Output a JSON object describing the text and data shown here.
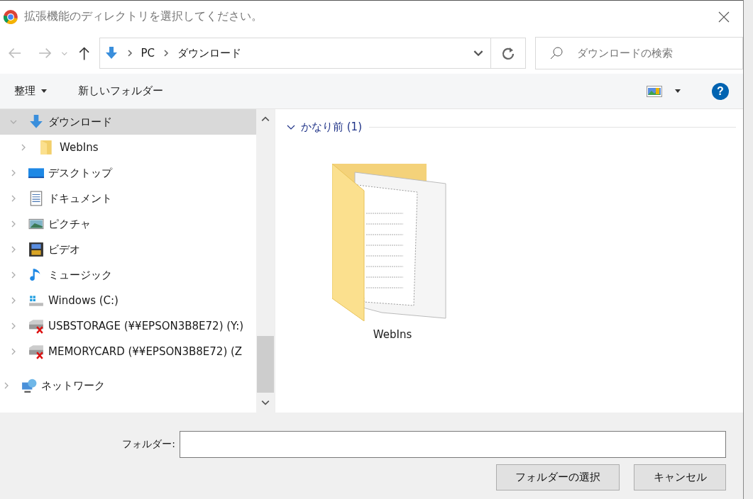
{
  "window": {
    "title": "拡張機能のディレクトリを選択してください。"
  },
  "address_bar": {
    "crumbs": [
      "PC",
      "ダウンロード"
    ]
  },
  "search": {
    "placeholder": "ダウンロードの検索"
  },
  "toolbar": {
    "organize": "整理",
    "new_folder": "新しいフォルダー",
    "help": "?"
  },
  "nav_tree": [
    {
      "label": "ダウンロード",
      "kind": "download",
      "selected": true,
      "expanded": true,
      "children": [
        {
          "label": "WebIns",
          "kind": "folder",
          "selected": false,
          "expanded": false
        }
      ]
    },
    {
      "label": "デスクトップ",
      "kind": "desktop",
      "selected": false,
      "expanded": false
    },
    {
      "label": "ドキュメント",
      "kind": "document",
      "selected": false,
      "expanded": false
    },
    {
      "label": "ピクチャ",
      "kind": "picture",
      "selected": false,
      "expanded": false
    },
    {
      "label": "ビデオ",
      "kind": "video",
      "selected": false,
      "expanded": false
    },
    {
      "label": "ミュージック",
      "kind": "music",
      "selected": false,
      "expanded": false
    },
    {
      "label": "Windows (C:)",
      "kind": "drive",
      "selected": false,
      "expanded": false
    },
    {
      "label": "USBSTORAGE (¥¥EPSON3B8E72) (Y:)",
      "kind": "netdrive",
      "selected": false,
      "expanded": false
    },
    {
      "label": "MEMORYCARD (¥¥EPSON3B8E72) (Z",
      "kind": "netdrive",
      "selected": false,
      "expanded": false
    }
  ],
  "network_item": {
    "label": "ネットワーク",
    "kind": "network",
    "expanded": false
  },
  "content": {
    "group": {
      "label": "かなり前 (1)",
      "expanded": true
    },
    "items": [
      {
        "name": "WebIns"
      }
    ]
  },
  "footer": {
    "folder_label": "フォルダー:",
    "select_button": "フォルダーの選択",
    "cancel_button": "キャンセル"
  }
}
